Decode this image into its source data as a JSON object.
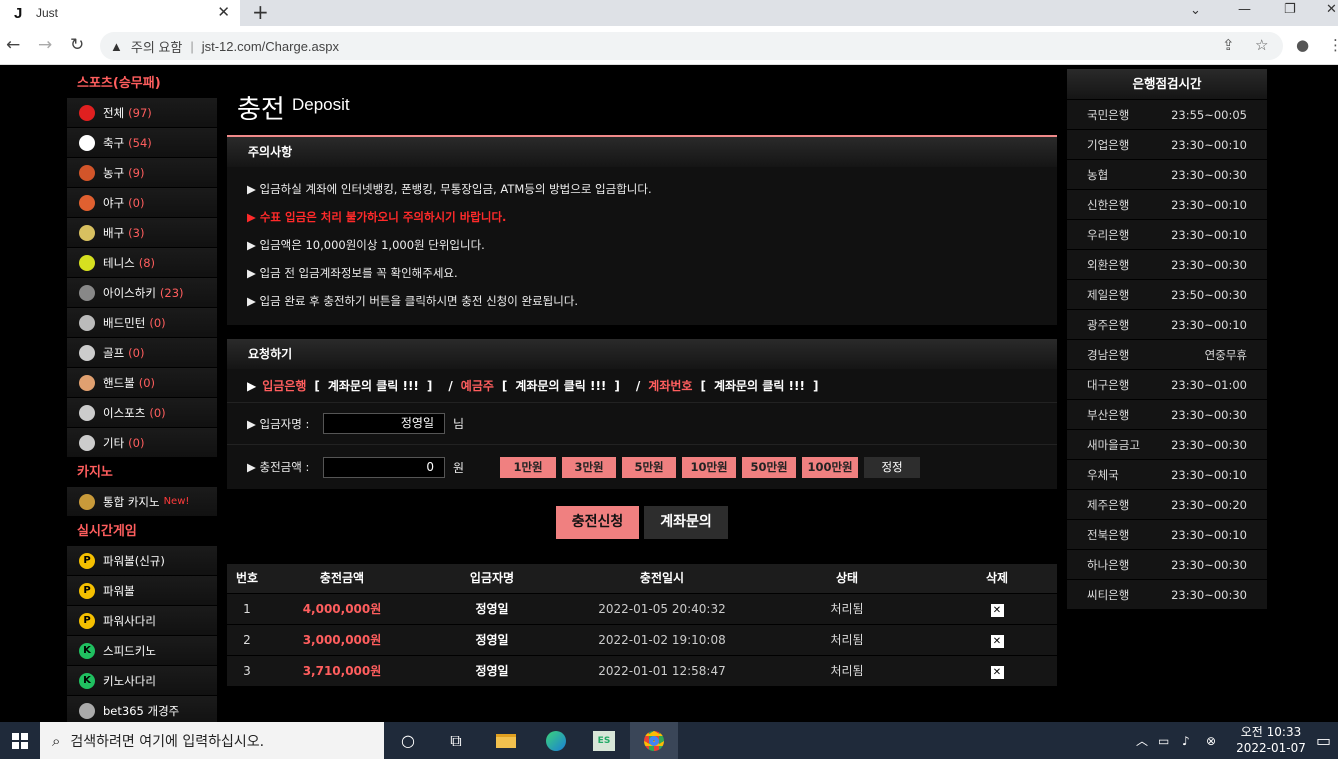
{
  "browser": {
    "tab_title": "Just",
    "favicon": "J",
    "security_label": "주의 요함",
    "url": "jst-12.com/Charge.aspx"
  },
  "sidebar": {
    "sports_header": "스포츠(승무패)",
    "sports": [
      {
        "label": "전체",
        "count": "(97)",
        "icon": "star-icon",
        "color": "#e02020"
      },
      {
        "label": "축구",
        "count": "(54)",
        "icon": "soccer-ball-icon",
        "color": "#ffffff"
      },
      {
        "label": "농구",
        "count": "(9)",
        "icon": "basketball-icon",
        "color": "#d2552a"
      },
      {
        "label": "야구",
        "count": "(0)",
        "icon": "baseball-icon",
        "color": "#e06030"
      },
      {
        "label": "배구",
        "count": "(3)",
        "icon": "volleyball-icon",
        "color": "#d8c060"
      },
      {
        "label": "테니스",
        "count": "(8)",
        "icon": "tennis-ball-icon",
        "color": "#d6e020"
      },
      {
        "label": "아이스하키",
        "count": "(23)",
        "icon": "hockey-puck-icon",
        "color": "#888888"
      },
      {
        "label": "배드민턴",
        "count": "(0)",
        "icon": "shuttlecock-icon",
        "color": "#bbbbbb"
      },
      {
        "label": "골프",
        "count": "(0)",
        "icon": "golf-icon",
        "color": "#cccccc"
      },
      {
        "label": "핸드볼",
        "count": "(0)",
        "icon": "handball-icon",
        "color": "#e0a070"
      },
      {
        "label": "이스포츠",
        "count": "(0)",
        "icon": "gamepad-icon",
        "color": "#cccccc"
      },
      {
        "label": "기타",
        "count": "(0)",
        "icon": "misc-sport-icon",
        "color": "#cccccc"
      }
    ],
    "casino_header": "카지노",
    "casino": [
      {
        "label": "통합 카지노",
        "badge": "New!",
        "icon": "casino-chip-icon",
        "color": "#c89a3a"
      }
    ],
    "live_header": "실시간게임",
    "live": [
      {
        "label": "파워볼(신규)",
        "icon": "powerball-icon",
        "letter": "P",
        "color": "#f5c000"
      },
      {
        "label": "파워볼",
        "icon": "powerball-icon",
        "letter": "P",
        "color": "#f5c000"
      },
      {
        "label": "파워사다리",
        "icon": "powerball-icon",
        "letter": "P",
        "color": "#f5c000"
      },
      {
        "label": "스피드키노",
        "icon": "keno-icon",
        "letter": "K",
        "color": "#20c060"
      },
      {
        "label": "키노사다리",
        "icon": "keno-icon",
        "letter": "K",
        "color": "#20c060"
      },
      {
        "label": "bet365 개경주",
        "icon": "greyhound-icon",
        "letter": "",
        "color": "#aaaaaa"
      }
    ]
  },
  "main": {
    "title_ko": "충전",
    "title_en": "Deposit",
    "notice_title": "주의사항",
    "notices": [
      {
        "text": "▶ 입금하실 계좌에 인터넷뱅킹, 폰뱅킹, 무통장입금, ATM등의 방법으로 입금합니다.",
        "red": false
      },
      {
        "text": "▶ 수표 입금은 처리 불가하오니 주의하시기 바랍니다.",
        "red": true
      },
      {
        "text": "▶ 입금액은 10,000원이상 1,000원 단위입니다.",
        "red": false
      },
      {
        "text": "▶ 입금 전 입금계좌정보를 꼭 확인해주세요.",
        "red": false
      },
      {
        "text": "▶ 입금 완료 후 충전하기 버튼을 클릭하시면 충전 신청이 완료됩니다.",
        "red": false
      }
    ],
    "request_title": "요청하기",
    "account": {
      "arrow": "▶",
      "bank_label": "입금은행",
      "bank_value": "계좌문의 클릭 !!!",
      "holder_label": "예금주",
      "holder_value": "계좌문의 클릭 !!!",
      "number_label": "계좌번호",
      "number_value": "계좌문의 클릭 !!!",
      "slash": "/",
      "open_bracket": "[",
      "close_bracket": "]"
    },
    "depositor": {
      "label": "▶ 입금자명 :",
      "value": "정영일",
      "suffix": "님"
    },
    "amount": {
      "label": "▶ 충전금액 :",
      "value": "0",
      "suffix": "원"
    },
    "amount_buttons": [
      "1만원",
      "3만원",
      "5만원",
      "10만원",
      "50만원",
      "100만원"
    ],
    "reset_label": "정정",
    "submit_label": "충전신청",
    "inquiry_label": "계좌문의",
    "history": {
      "headers": [
        "번호",
        "충전금액",
        "입금자명",
        "충전일시",
        "상태",
        "삭제"
      ],
      "rows": [
        {
          "no": "1",
          "amount": "4,000,000원",
          "name": "정영일",
          "date": "2022-01-05 20:40:32",
          "status": "처리됨",
          "del": "✕"
        },
        {
          "no": "2",
          "amount": "3,000,000원",
          "name": "정영일",
          "date": "2022-01-02 19:10:08",
          "status": "처리됨",
          "del": "✕"
        },
        {
          "no": "3",
          "amount": "3,710,000원",
          "name": "정영일",
          "date": "2022-01-01 12:58:47",
          "status": "처리됨",
          "del": "✕"
        }
      ]
    }
  },
  "bank_hours": {
    "title": "은행점검시간",
    "rows": [
      {
        "bank": "국민은행",
        "time": "23:55~00:05"
      },
      {
        "bank": "기업은행",
        "time": "23:30~00:10"
      },
      {
        "bank": "농협",
        "time": "23:30~00:30"
      },
      {
        "bank": "신한은행",
        "time": "23:30~00:10"
      },
      {
        "bank": "우리은행",
        "time": "23:30~00:10"
      },
      {
        "bank": "외환은행",
        "time": "23:30~00:30"
      },
      {
        "bank": "제일은행",
        "time": "23:50~00:30"
      },
      {
        "bank": "광주은행",
        "time": "23:30~00:10"
      },
      {
        "bank": "경남은행",
        "time": "연중무휴"
      },
      {
        "bank": "대구은행",
        "time": "23:30~01:00"
      },
      {
        "bank": "부산은행",
        "time": "23:30~00:30"
      },
      {
        "bank": "새마을금고",
        "time": "23:30~00:30"
      },
      {
        "bank": "우체국",
        "time": "23:30~00:10"
      },
      {
        "bank": "제주은행",
        "time": "23:30~00:20"
      },
      {
        "bank": "전북은행",
        "time": "23:30~00:10"
      },
      {
        "bank": "하나은행",
        "time": "23:30~00:30"
      },
      {
        "bank": "씨티은행",
        "time": "23:30~00:30"
      }
    ]
  },
  "taskbar": {
    "search_placeholder": "검색하려면 여기에 입력하십시오.",
    "time": "오전 10:33",
    "date": "2022-01-07"
  }
}
